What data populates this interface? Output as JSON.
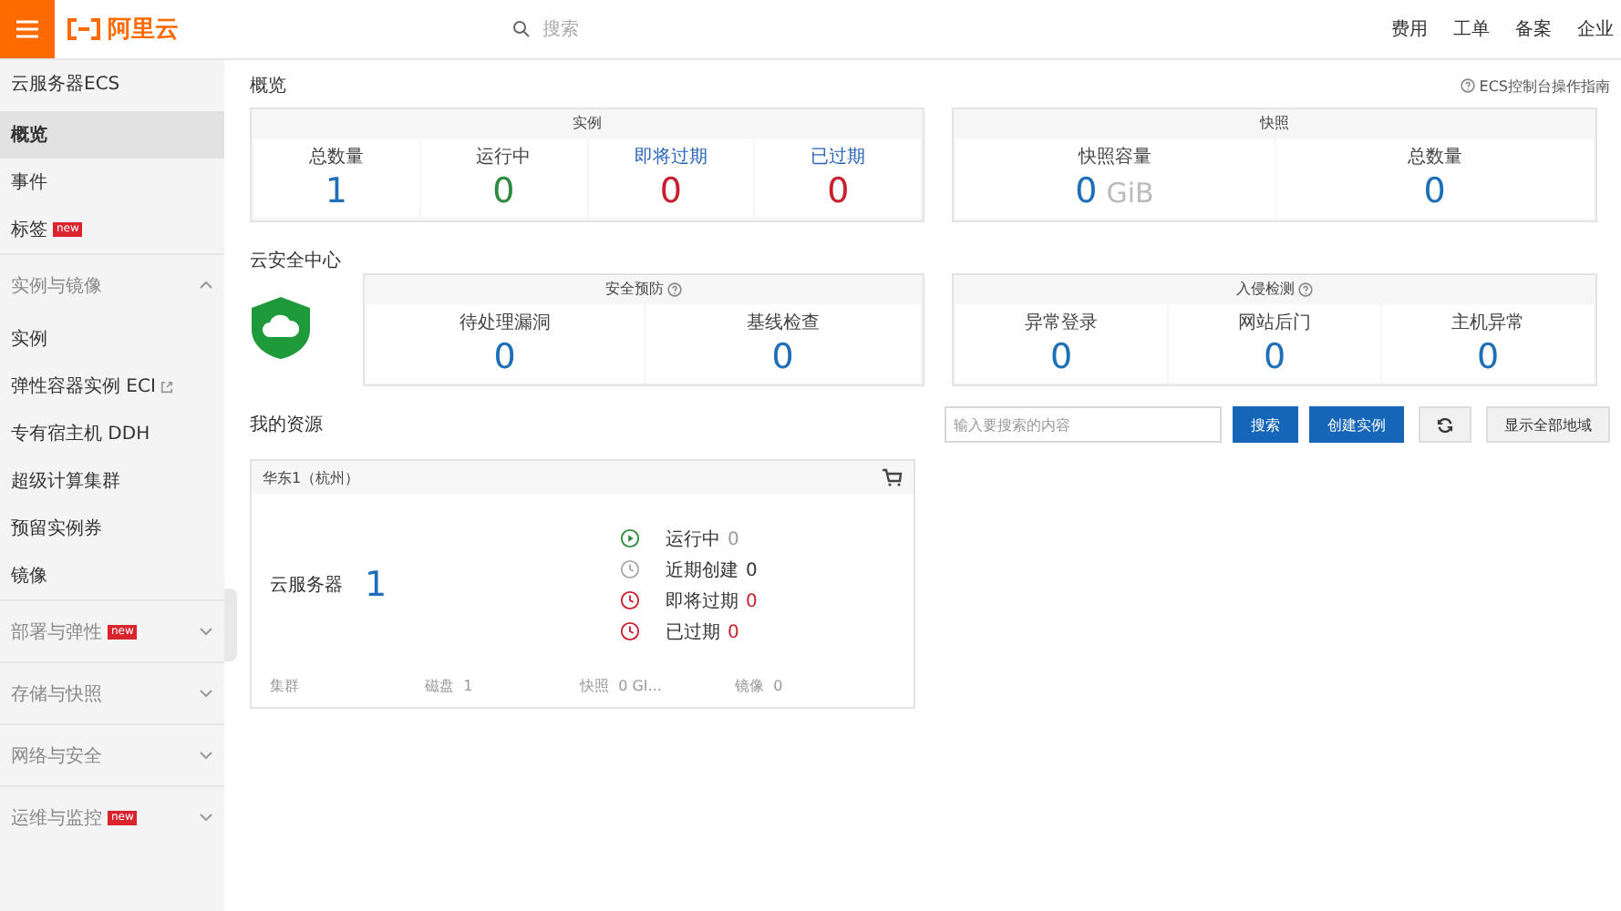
{
  "header": {
    "logo": "阿里云",
    "search_placeholder": "搜索",
    "links": [
      "费用",
      "工单",
      "备案",
      "企业"
    ]
  },
  "sidebar": {
    "title": "云服务器ECS",
    "items": [
      {
        "kind": "item",
        "label": "概览",
        "selected": true
      },
      {
        "kind": "item",
        "label": "事件",
        "selected": false
      },
      {
        "kind": "item",
        "label": "标签",
        "selected": false,
        "badge": "new"
      },
      {
        "kind": "group",
        "label": "实例与镜像",
        "expanded": true,
        "children": [
          {
            "kind": "item",
            "label": "实例",
            "selected": false
          },
          {
            "kind": "item",
            "label": "弹性容器实例 ECI",
            "selected": false,
            "external": true
          },
          {
            "kind": "item",
            "label": "专有宿主机 DDH",
            "selected": false
          },
          {
            "kind": "item",
            "label": "超级计算集群",
            "selected": false
          },
          {
            "kind": "item",
            "label": "预留实例券",
            "selected": false
          },
          {
            "kind": "item",
            "label": "镜像",
            "selected": false
          }
        ]
      },
      {
        "kind": "group",
        "label": "部署与弹性",
        "expanded": false,
        "badge": "new"
      },
      {
        "kind": "group",
        "label": "存储与快照",
        "expanded": false
      },
      {
        "kind": "group",
        "label": "网络与安全",
        "expanded": false
      },
      {
        "kind": "group",
        "label": "运维与监控",
        "expanded": false,
        "badge": "new"
      }
    ]
  },
  "main": {
    "breadcrumb": "概览",
    "help_link": "ECS控制台操作指南",
    "summary_cards": [
      {
        "title": "实例",
        "stats": [
          {
            "label": "总数量",
            "value": "1",
            "color": "#1e6fb8",
            "link": false
          },
          {
            "label": "运行中",
            "value": "0",
            "color": "#2e8b3e",
            "link": false
          },
          {
            "label": "即将过期",
            "value": "0",
            "color": "#c8202f",
            "link": true
          },
          {
            "label": "已过期",
            "value": "0",
            "color": "#c8202f",
            "link": true
          }
        ]
      },
      {
        "title": "快照",
        "stats": [
          {
            "label": "快照容量",
            "value": "0",
            "unit": "GiB",
            "color": "#1e6fb8",
            "link": false
          },
          {
            "label": "总数量",
            "value": "0",
            "color": "#1e6fb8",
            "link": false
          }
        ]
      }
    ],
    "security": {
      "title": "云安全中心",
      "cards": [
        {
          "title": "安全预防",
          "stats": [
            {
              "label": "待处理漏洞",
              "value": "0",
              "color": "#1e6fb8",
              "link": false
            },
            {
              "label": "基线检查",
              "value": "0",
              "color": "#1e6fb8",
              "link": false
            }
          ]
        },
        {
          "title": "入侵检测",
          "stats": [
            {
              "label": "异常登录",
              "value": "0",
              "color": "#1e6fb8",
              "link": false
            },
            {
              "label": "网站后门",
              "value": "0",
              "color": "#1e6fb8",
              "link": false
            },
            {
              "label": "主机异常",
              "value": "0",
              "color": "#1e6fb8",
              "link": false
            }
          ]
        }
      ]
    },
    "resources": {
      "title": "我的资源",
      "search_placeholder": "输入要搜索的内容",
      "buttons": [
        "搜索",
        "创建实例"
      ],
      "region_button": "显示全部地域",
      "region": {
        "name": "华东1（杭州）",
        "server_label": "云服务器",
        "server_count": "1",
        "statuses": [
          {
            "kind": "running",
            "label": "运行中",
            "value": "0"
          },
          {
            "kind": "recent",
            "label": "近期创建",
            "value": "0"
          },
          {
            "kind": "expiring",
            "label": "即将过期",
            "value": "0"
          },
          {
            "kind": "expired",
            "label": "已过期",
            "value": "0"
          }
        ],
        "footer": [
          {
            "label": "集群"
          },
          {
            "label": "磁盘",
            "value": "1"
          },
          {
            "label": "快照",
            "value": "0 GI..."
          },
          {
            "label": "镜像",
            "value": "0"
          }
        ]
      }
    }
  }
}
